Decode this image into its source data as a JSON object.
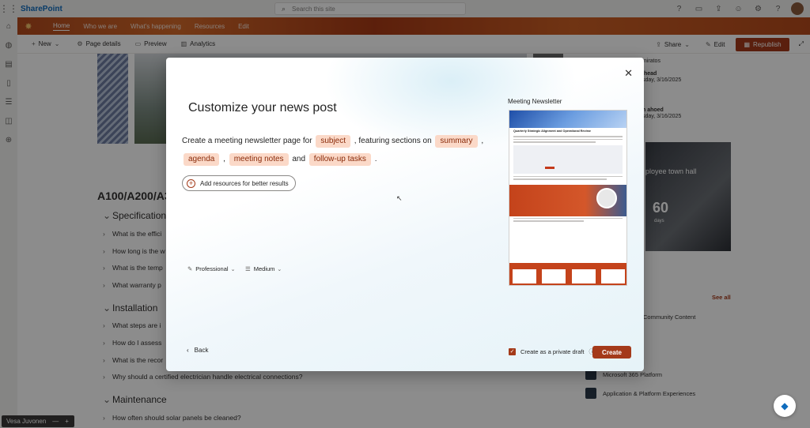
{
  "topbar": {
    "app_name": "SharePoint",
    "search_placeholder": "Search this site",
    "icons": [
      "question-icon",
      "chat-icon",
      "share-icon",
      "feedback-icon",
      "settings-icon",
      "help-icon"
    ]
  },
  "hubnav": {
    "items": [
      "Home",
      "Who we are",
      "What's happening",
      "Resources",
      "Edit"
    ]
  },
  "cmdbar": {
    "new": "New",
    "page_details": "Page details",
    "preview": "Preview",
    "analytics": "Analytics",
    "share": "Share",
    "edit": "Edit",
    "republish": "Republish"
  },
  "page": {
    "doc_title": "A100/A200/A3",
    "sections": [
      {
        "label": "Specification",
        "items": [
          "What is the effici",
          "How long is the w",
          "What is the temp",
          "What warranty p"
        ]
      },
      {
        "label": "Installation",
        "items": [
          "What steps are i",
          "How do I assess",
          "What is the recor",
          "Why should a certified electrician handle electrical connections?"
        ]
      },
      {
        "label": "Maintenance",
        "items": [
          "How often should solar panels be cleaned?"
        ]
      }
    ],
    "right": {
      "news1_author": "miratos",
      "news1_meta1": "lhead",
      "news1_date": "sday, 3/16/2025",
      "news2_author": "h ahoed",
      "news2_date": "sday, 3/16/2025",
      "townhall_title": "ployee town hall",
      "townhall_count": "60",
      "townhall_unit": "days",
      "see_all": "See all",
      "community": "Community Content",
      "platform1": "Microsoft 365 Platform",
      "platform2": "Application & Platform Experiences"
    },
    "user_chip": "Vesa Juvonen"
  },
  "dialog": {
    "title": "Customize your news post",
    "prompt_start": "Create a meeting newsletter page for",
    "chip_subject": "subject",
    "prompt_mid1": ", featuring sections on",
    "chip_summary": "summary",
    "comma1": ",",
    "chip_agenda": "agenda",
    "comma2": ",",
    "chip_notes": "meeting notes",
    "and": "and",
    "chip_tasks": "follow-up tasks",
    "period": ".",
    "add_resources": "Add resources for better results",
    "tone": "Professional",
    "length": "Medium",
    "back": "Back",
    "preview_label": "Meeting Newsletter",
    "preview_title": "Quarterly Strategic Alignment and Operational Review",
    "private_draft": "Create as a private draft",
    "create": "Create"
  }
}
